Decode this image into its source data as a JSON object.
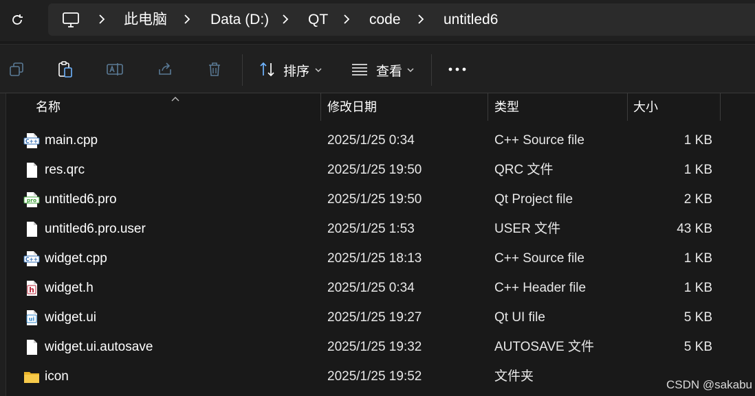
{
  "address_bar": {
    "crumbs": [
      "此电脑",
      "Data (D:)",
      "QT",
      "code",
      "untitled6"
    ]
  },
  "toolbar": {
    "sort_label": "排序",
    "view_label": "查看"
  },
  "columns": {
    "name": "名称",
    "date": "修改日期",
    "type": "类型",
    "size": "大小"
  },
  "files": [
    {
      "name": "main.cpp",
      "date": "2025/1/25 0:34",
      "type": "C++ Source file",
      "size": "1 KB",
      "icon": "cpp-file-icon"
    },
    {
      "name": "res.qrc",
      "date": "2025/1/25 19:50",
      "type": "QRC 文件",
      "size": "1 KB",
      "icon": "generic-file-icon"
    },
    {
      "name": "untitled6.pro",
      "date": "2025/1/25 19:50",
      "type": "Qt Project file",
      "size": "2 KB",
      "icon": "pro-file-icon"
    },
    {
      "name": "untitled6.pro.user",
      "date": "2025/1/25 1:53",
      "type": "USER 文件",
      "size": "43 KB",
      "icon": "generic-file-icon"
    },
    {
      "name": "widget.cpp",
      "date": "2025/1/25 18:13",
      "type": "C++ Source file",
      "size": "1 KB",
      "icon": "cpp-file-icon"
    },
    {
      "name": "widget.h",
      "date": "2025/1/25 0:34",
      "type": "C++ Header file",
      "size": "1 KB",
      "icon": "header-file-icon"
    },
    {
      "name": "widget.ui",
      "date": "2025/1/25 19:27",
      "type": "Qt UI file",
      "size": "5 KB",
      "icon": "ui-file-icon"
    },
    {
      "name": "widget.ui.autosave",
      "date": "2025/1/25 19:32",
      "type": "AUTOSAVE 文件",
      "size": "5 KB",
      "icon": "generic-file-icon"
    },
    {
      "name": "icon",
      "date": "2025/1/25 19:52",
      "type": "文件夹",
      "size": "",
      "icon": "folder-icon"
    }
  ],
  "watermark": "CSDN @sakabu"
}
